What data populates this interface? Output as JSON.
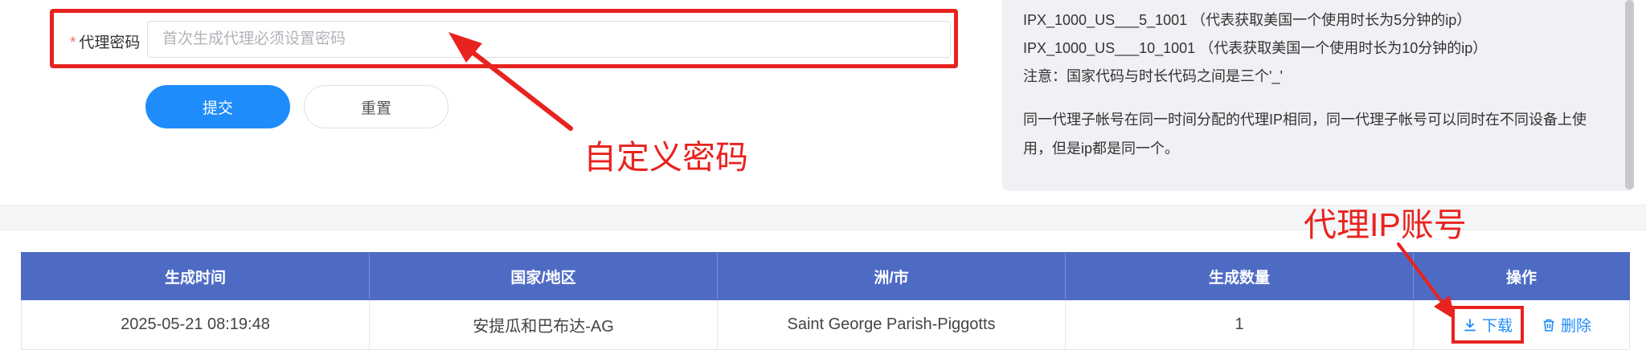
{
  "form": {
    "field_required_mark": "*",
    "field_label": "代理密码",
    "field_placeholder": "首次生成代理必须设置密码",
    "field_value": "",
    "submit_label": "提交",
    "reset_label": "重置"
  },
  "annotations": {
    "password": "自定义密码",
    "account": "代理IP账号"
  },
  "info": {
    "lines": [
      "IPX_1000_US___5_1001 （代表获取美国一个使用时长为5分钟的ip）",
      "IPX_1000_US___10_1001 （代表获取美国一个使用时长为10分钟的ip）",
      "注意：国家代码与时长代码之间是三个'_'"
    ],
    "paragraph": "同一代理子帐号在同一时间分配的代理IP相同，同一代理子帐号可以同时在不同设备上使用，但是ip都是同一个。"
  },
  "table": {
    "headers": [
      "生成时间",
      "国家/地区",
      "洲/市",
      "生成数量",
      "操作"
    ],
    "rows": [
      {
        "time": "2025-05-21 08:19:48",
        "country": "安提瓜和巴布达-AG",
        "city": "Saint George Parish-Piggotts",
        "count": "1",
        "download_label": "下载",
        "delete_label": "删除"
      }
    ]
  },
  "colors": {
    "primary": "#1f8cfb",
    "table_header": "#4e6bc4",
    "annotation": "#e8231f"
  },
  "icons": [
    "download-icon",
    "trash-icon"
  ]
}
